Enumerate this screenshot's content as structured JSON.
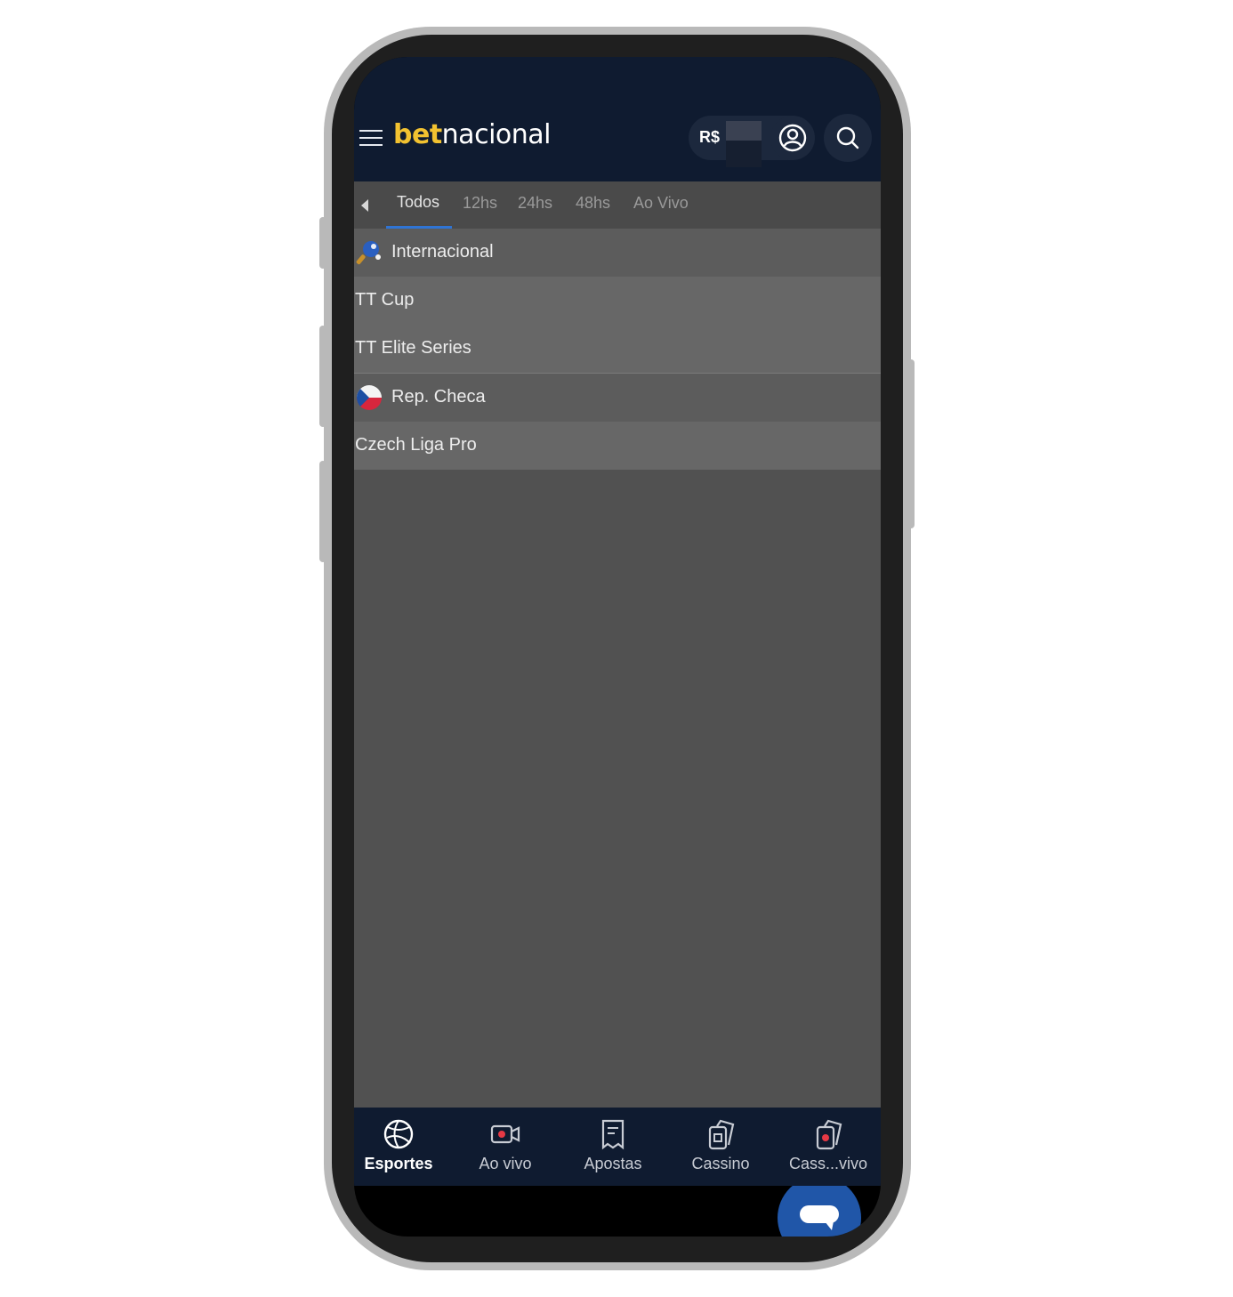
{
  "header": {
    "logo_bet": "bet",
    "logo_nacional": "nacional",
    "currency": "R$"
  },
  "tabs": [
    {
      "label": "Todos",
      "active": true
    },
    {
      "label": "12hs",
      "active": false
    },
    {
      "label": "24hs",
      "active": false
    },
    {
      "label": "48hs",
      "active": false
    },
    {
      "label": "Ao Vivo",
      "active": false
    }
  ],
  "list": [
    {
      "type": "country",
      "label": "Internacional",
      "icon": "table-tennis-icon"
    },
    {
      "type": "league",
      "label": "TT Cup"
    },
    {
      "type": "league",
      "label": "TT Elite Series"
    },
    {
      "type": "country",
      "label": "Rep. Checa",
      "icon": "czech-flag-icon"
    },
    {
      "type": "league",
      "label": "Czech Liga Pro"
    }
  ],
  "bottom_nav": [
    {
      "label": "Esportes",
      "icon": "ball-icon",
      "active": true
    },
    {
      "label": "Ao vivo",
      "icon": "live-video-icon",
      "active": false
    },
    {
      "label": "Apostas",
      "icon": "receipt-icon",
      "active": false
    },
    {
      "label": "Cassino",
      "icon": "casino-cards-icon",
      "active": false
    },
    {
      "label": "Cass...vivo",
      "icon": "live-casino-icon",
      "active": false
    }
  ],
  "colors": {
    "header_bg": "#0f1b30",
    "logo_accent": "#f2c230",
    "tab_active_underline": "#2f74d4",
    "chat_button": "#2056a8"
  }
}
